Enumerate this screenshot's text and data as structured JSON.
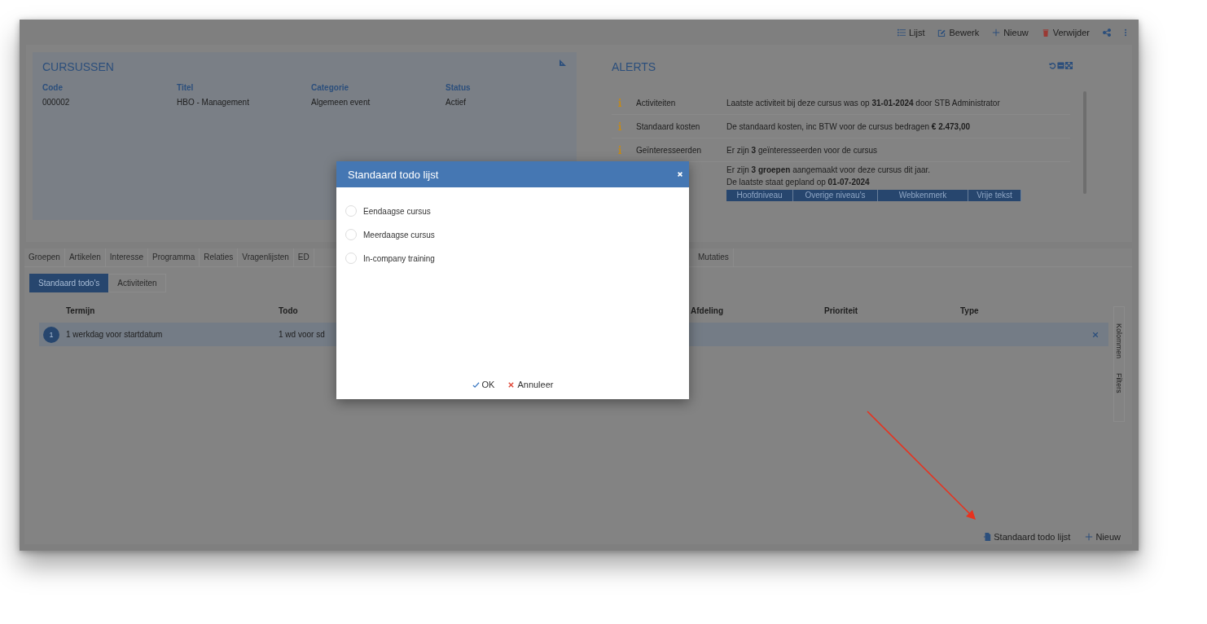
{
  "toolbar": [
    {
      "kind": "list",
      "label": "Lijst"
    },
    {
      "kind": "edit",
      "label": "Bewerk"
    },
    {
      "kind": "plus",
      "label": "Nieuw"
    },
    {
      "kind": "trash",
      "label": "Verwijder"
    }
  ],
  "course_card": {
    "title": "CURSUSSEN",
    "columns": [
      "Code",
      "Titel",
      "Categorie",
      "Status"
    ],
    "values": [
      "000002",
      "HBO - Management",
      "Algemeen event",
      "Actief"
    ]
  },
  "alerts": {
    "title": "ALERTS",
    "rows": [
      {
        "label": "Activiteiten",
        "text": "Laatste activiteit bij deze cursus was op **31-01-2024** door STB Administrator"
      },
      {
        "label": "Standaard kosten",
        "text": "De standaard kosten, inc BTW voor de cursus bedragen **€ 2.473,00**"
      },
      {
        "label": "Geïnteresseerden",
        "text": "Er zijn **3** geïnteresseerden voor de cursus"
      }
    ],
    "group_lines": [
      "Er zijn **3 groepen** aangemaakt voor deze cursus dit jaar.",
      "De laatste staat gepland op **01-07-2024**"
    ],
    "level_tabs": [
      "Hoofdniveau",
      "Overige niveau's",
      "Webkenmerk",
      "Vrije tekst"
    ]
  },
  "tabs_left": [
    {
      "label": "Groepen",
      "selected": false
    },
    {
      "label": "Artikelen",
      "selected": false
    },
    {
      "label": "Interesse",
      "selected": false
    },
    {
      "label": "Programma",
      "selected": false
    },
    {
      "label": "Relaties",
      "selected": false
    },
    {
      "label": "Vragenlijsten",
      "selected": false
    },
    {
      "label": "ED",
      "selected": false
    }
  ],
  "tabs_right": [
    {
      "label": "Mutaties",
      "selected": false
    }
  ],
  "sub_tabs": [
    {
      "label": "Standaard todo's",
      "selected": true
    },
    {
      "label": "Activiteiten",
      "selected": false
    }
  ],
  "table": {
    "columns": [
      "Termijn",
      "Todo",
      "Afdeling",
      "Prioriteit",
      "Type"
    ],
    "rows": [
      {
        "number": "1",
        "termijn": "1 werkdag voor startdatum",
        "todo": "1 wd voor sd",
        "selected": true
      }
    ]
  },
  "side_tabs": [
    "Kolommen",
    "Filters"
  ],
  "footer": [
    {
      "kind": "doc",
      "label": "Standaard todo lijst"
    },
    {
      "kind": "plus",
      "label": "Nieuw"
    }
  ],
  "dialog": {
    "title": "Standaard todo lijst",
    "options": [
      {
        "label": "Eendaagse cursus",
        "selected": false
      },
      {
        "label": "Meerdaagse cursus",
        "selected": false
      },
      {
        "label": "In-company training",
        "selected": false
      }
    ],
    "ok": "OK",
    "cancel": "Annuleer"
  }
}
